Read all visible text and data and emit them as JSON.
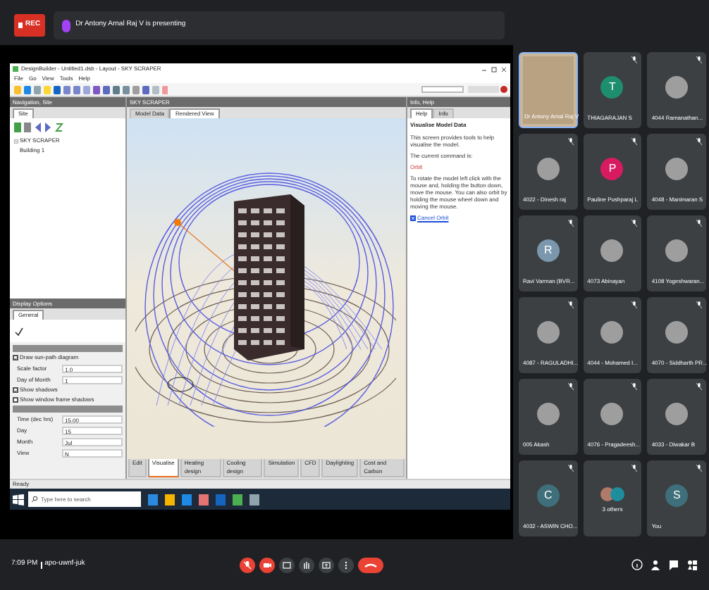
{
  "meeting": {
    "recording_label": "REC",
    "presenter_banner": "Dr Antony Arnal Raj V is presenting"
  },
  "shared_screen": {
    "window_title": "DesignBuilder - Untitled1.dsb - Layout - SKY SCRAPER",
    "menu": [
      "File",
      "Go",
      "View",
      "Tools",
      "Help"
    ],
    "navigation_panel": {
      "title": "Navigation, Site",
      "tabs": [
        {
          "label": "Site",
          "selected": true
        }
      ],
      "tree": [
        {
          "label": "SKY SCRAPER",
          "expanded": true,
          "children": [
            {
              "label": "Building 1"
            }
          ]
        }
      ]
    },
    "viewport": {
      "title": "SKY SCRAPER",
      "tabs": [
        {
          "label": "Model Data",
          "selected": false
        },
        {
          "label": "Rendered View",
          "selected": true
        }
      ],
      "bottom_tabs": [
        {
          "label": "Edit",
          "selected": false
        },
        {
          "label": "Visualise",
          "selected": true
        },
        {
          "label": "Heating design",
          "selected": false
        },
        {
          "label": "Cooling design",
          "selected": false
        },
        {
          "label": "Simulation",
          "selected": false
        },
        {
          "label": "CFD",
          "selected": false
        },
        {
          "label": "Daylighting",
          "selected": false
        },
        {
          "label": "Cost and Carbon",
          "selected": false
        }
      ]
    },
    "display_options": {
      "title": "Display Options",
      "tabs": [
        {
          "label": "General",
          "selected": true
        }
      ],
      "rows": [
        {
          "kind": "section"
        },
        {
          "kind": "checkbox",
          "label": "Draw sun-path diagram",
          "checked": true
        },
        {
          "kind": "field",
          "label": "Scale factor",
          "value": "1.0"
        },
        {
          "kind": "field",
          "label": "Day of Month",
          "value": "1"
        },
        {
          "kind": "checkbox",
          "label": "Show shadows",
          "checked": true
        },
        {
          "kind": "checkbox",
          "label": "Show window frame shadows",
          "checked": false
        },
        {
          "kind": "section"
        },
        {
          "kind": "field",
          "label": "Time (dec hrs)",
          "value": "15.00"
        },
        {
          "kind": "field",
          "label": "Day",
          "value": "15"
        },
        {
          "kind": "field",
          "label": "Month",
          "value": "Jul"
        },
        {
          "kind": "field",
          "label": "View",
          "value": "N"
        }
      ]
    },
    "help_panel": {
      "title": "Info, Help",
      "tabs": [
        {
          "label": "Help",
          "selected": true
        },
        {
          "label": "Info",
          "selected": false
        }
      ],
      "heading": "Visualise Model Data",
      "paragraphs": [
        {
          "kind": "text",
          "text": "This screen provides tools to help visualise the model."
        },
        {
          "kind": "text",
          "text": "The current command is:"
        },
        {
          "kind": "alert",
          "text": "Orbit"
        },
        {
          "kind": "text",
          "text": "To rotate the model left click with the mouse and, holding the button down, move the mouse. You can also orbit by holding the mouse wheel down and moving the mouse."
        }
      ],
      "link": "Cancel Orbit"
    },
    "status": "Ready",
    "taskbar": {
      "search_placeholder": "Type here to search"
    }
  },
  "footer": {
    "time": "7:09 PM",
    "meeting_code": "apo-uwnf-juk"
  },
  "participants": [
    {
      "name": "Dr Antony Arnal Raj V",
      "kind": "video",
      "selected": true
    },
    {
      "name": "THIAGARAJAN S",
      "kind": "letter",
      "letter": "T",
      "color": "#1e8e6e",
      "selected": false
    },
    {
      "name": "4044 Ramanathan...",
      "kind": "photo",
      "selected": false
    },
    {
      "name": "4022 - Dinesh raj",
      "kind": "photo",
      "selected": false
    },
    {
      "name": "Pauline Pushparaj L",
      "kind": "letter",
      "letter": "P",
      "color": "#d81b60",
      "selected": false
    },
    {
      "name": "4048 - Manimaran S",
      "kind": "photo",
      "selected": false
    },
    {
      "name": "Ravi Varman (BVR...",
      "kind": "letter",
      "letter": "R",
      "color": "#7b97ad",
      "selected": false
    },
    {
      "name": "4073 Abinayan",
      "kind": "photo",
      "selected": false
    },
    {
      "name": "4108 Yogeshwaran...",
      "kind": "photo",
      "selected": false
    },
    {
      "name": "4087 - RAGULADHI...",
      "kind": "photo",
      "selected": false
    },
    {
      "name": "4044 - Mohamed I...",
      "kind": "photo",
      "selected": false
    },
    {
      "name": "4070 - Siddharth PR...",
      "kind": "photo",
      "selected": false
    },
    {
      "name": "005 Akash",
      "kind": "photo",
      "selected": false
    },
    {
      "name": "4076 - Pragadeesh...",
      "kind": "photo",
      "selected": false
    },
    {
      "name": "4033 - Diwakar B",
      "kind": "photo",
      "selected": false
    },
    {
      "name": "4032 - ASWIN CHO...",
      "kind": "letter",
      "letter": "C",
      "color": "#3f6f7a",
      "selected": false
    },
    {
      "name": "3 others",
      "kind": "others",
      "selected": false
    },
    {
      "name": "You",
      "kind": "letter",
      "letter": "S",
      "color": "#3f6f7a",
      "selected": false
    }
  ]
}
